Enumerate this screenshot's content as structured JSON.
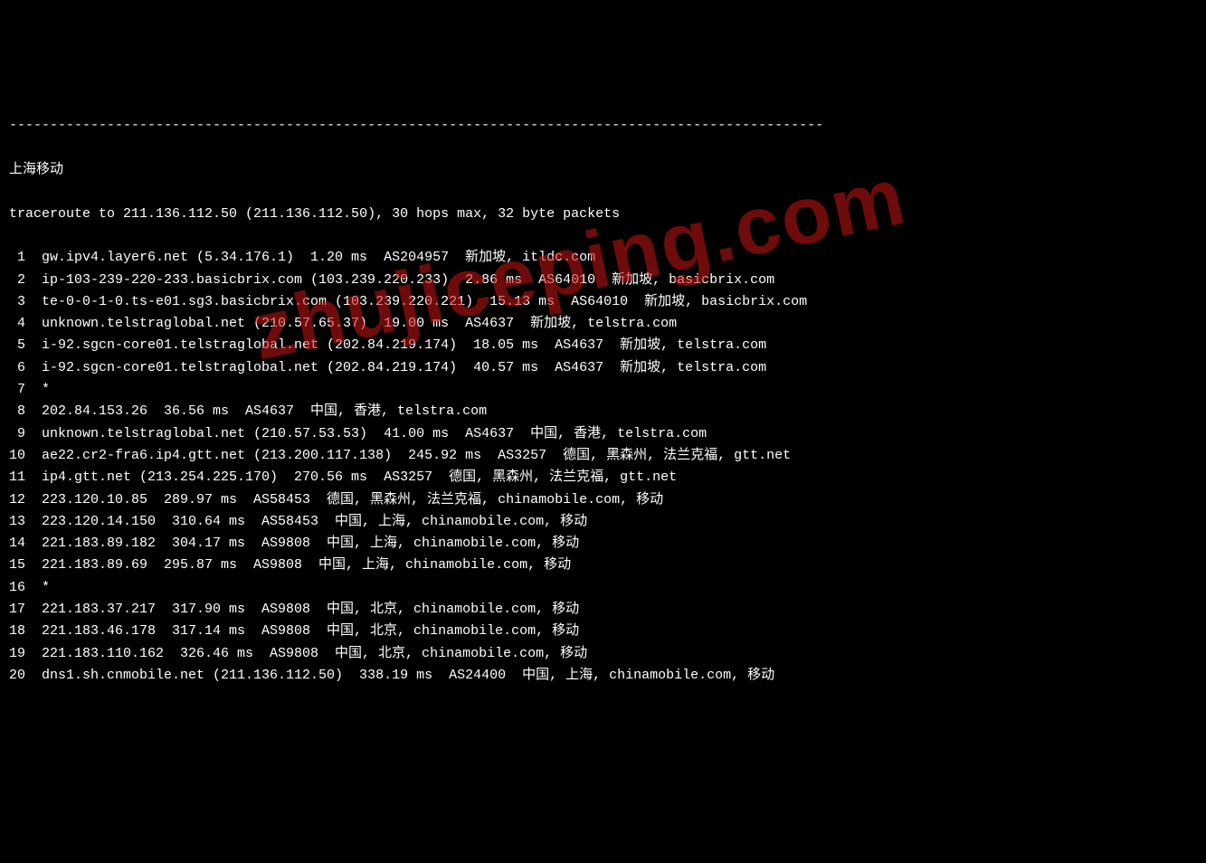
{
  "separator": "----------------------------------------------------------------------------------------------------",
  "title": "上海移动",
  "header": "traceroute to 211.136.112.50 (211.136.112.50), 30 hops max, 32 byte packets",
  "watermark": "zhujiceping.com",
  "hops": [
    {
      "num": "1",
      "text": "gw.ipv4.layer6.net (5.34.176.1)  1.20 ms  AS204957  新加坡, itldc.com"
    },
    {
      "num": "2",
      "text": "ip-103-239-220-233.basicbrix.com (103.239.220.233)  2.86 ms  AS64010  新加坡, basicbrix.com"
    },
    {
      "num": "3",
      "text": "te-0-0-1-0.ts-e01.sg3.basicbrix.com (103.239.220.221)  15.13 ms  AS64010  新加坡, basicbrix.com"
    },
    {
      "num": "4",
      "text": "unknown.telstraglobal.net (210.57.65.37)  19.00 ms  AS4637  新加坡, telstra.com"
    },
    {
      "num": "5",
      "text": "i-92.sgcn-core01.telstraglobal.net (202.84.219.174)  18.05 ms  AS4637  新加坡, telstra.com"
    },
    {
      "num": "6",
      "text": "i-92.sgcn-core01.telstraglobal.net (202.84.219.174)  40.57 ms  AS4637  新加坡, telstra.com"
    },
    {
      "num": "7",
      "text": "*"
    },
    {
      "num": "8",
      "text": "202.84.153.26  36.56 ms  AS4637  中国, 香港, telstra.com"
    },
    {
      "num": "9",
      "text": "unknown.telstraglobal.net (210.57.53.53)  41.00 ms  AS4637  中国, 香港, telstra.com"
    },
    {
      "num": "10",
      "text": "ae22.cr2-fra6.ip4.gtt.net (213.200.117.138)  245.92 ms  AS3257  德国, 黑森州, 法兰克福, gtt.net"
    },
    {
      "num": "11",
      "text": "ip4.gtt.net (213.254.225.170)  270.56 ms  AS3257  德国, 黑森州, 法兰克福, gtt.net"
    },
    {
      "num": "12",
      "text": "223.120.10.85  289.97 ms  AS58453  德国, 黑森州, 法兰克福, chinamobile.com, 移动"
    },
    {
      "num": "13",
      "text": "223.120.14.150  310.64 ms  AS58453  中国, 上海, chinamobile.com, 移动"
    },
    {
      "num": "14",
      "text": "221.183.89.182  304.17 ms  AS9808  中国, 上海, chinamobile.com, 移动"
    },
    {
      "num": "15",
      "text": "221.183.89.69  295.87 ms  AS9808  中国, 上海, chinamobile.com, 移动"
    },
    {
      "num": "16",
      "text": "*"
    },
    {
      "num": "17",
      "text": "221.183.37.217  317.90 ms  AS9808  中国, 北京, chinamobile.com, 移动"
    },
    {
      "num": "18",
      "text": "221.183.46.178  317.14 ms  AS9808  中国, 北京, chinamobile.com, 移动"
    },
    {
      "num": "19",
      "text": "221.183.110.162  326.46 ms  AS9808  中国, 北京, chinamobile.com, 移动"
    },
    {
      "num": "20",
      "text": "dns1.sh.cnmobile.net (211.136.112.50)  338.19 ms  AS24400  中国, 上海, chinamobile.com, 移动"
    }
  ]
}
